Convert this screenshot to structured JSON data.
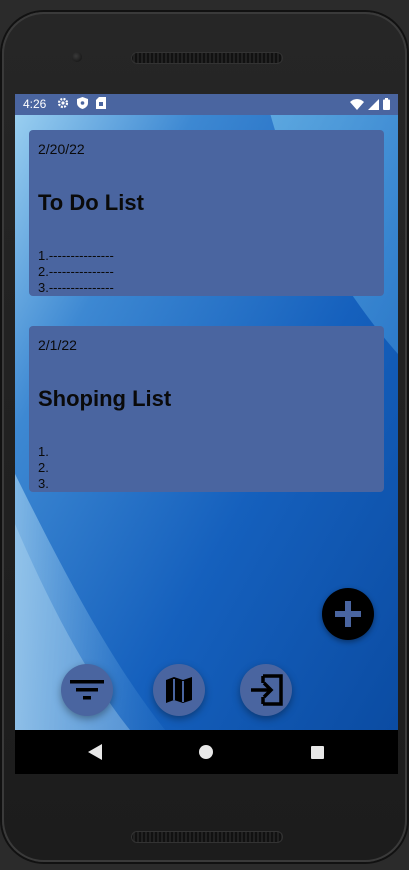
{
  "statusbar": {
    "time": "4:26",
    "left_icons": [
      "gear-icon",
      "shield-icon",
      "sim-card-icon"
    ],
    "right_icons": [
      "wifi-icon",
      "signal-icon",
      "battery-icon"
    ]
  },
  "notes": [
    {
      "date": "2/20/22",
      "title": "To Do List",
      "lines": [
        "1.---------------",
        "2.---------------",
        "3.---------------"
      ]
    },
    {
      "date": "2/1/22",
      "title": "Shoping List",
      "lines": [
        "1.",
        "2.",
        "3."
      ]
    }
  ],
  "fab": {
    "icon": "plus-icon"
  },
  "bottom_actions": [
    {
      "icon": "filter-icon"
    },
    {
      "icon": "map-icon"
    },
    {
      "icon": "exit-icon"
    }
  ],
  "navbar": {
    "icons": [
      "back-icon",
      "home-icon",
      "recents-icon"
    ]
  },
  "colors": {
    "card": "#4a65a0",
    "statusbar": "#4a65a0",
    "fab": "#000000",
    "navbar": "#000000",
    "wallpaper_dark": "#0b4fa6",
    "wallpaper_light": "#8ec6ea"
  }
}
